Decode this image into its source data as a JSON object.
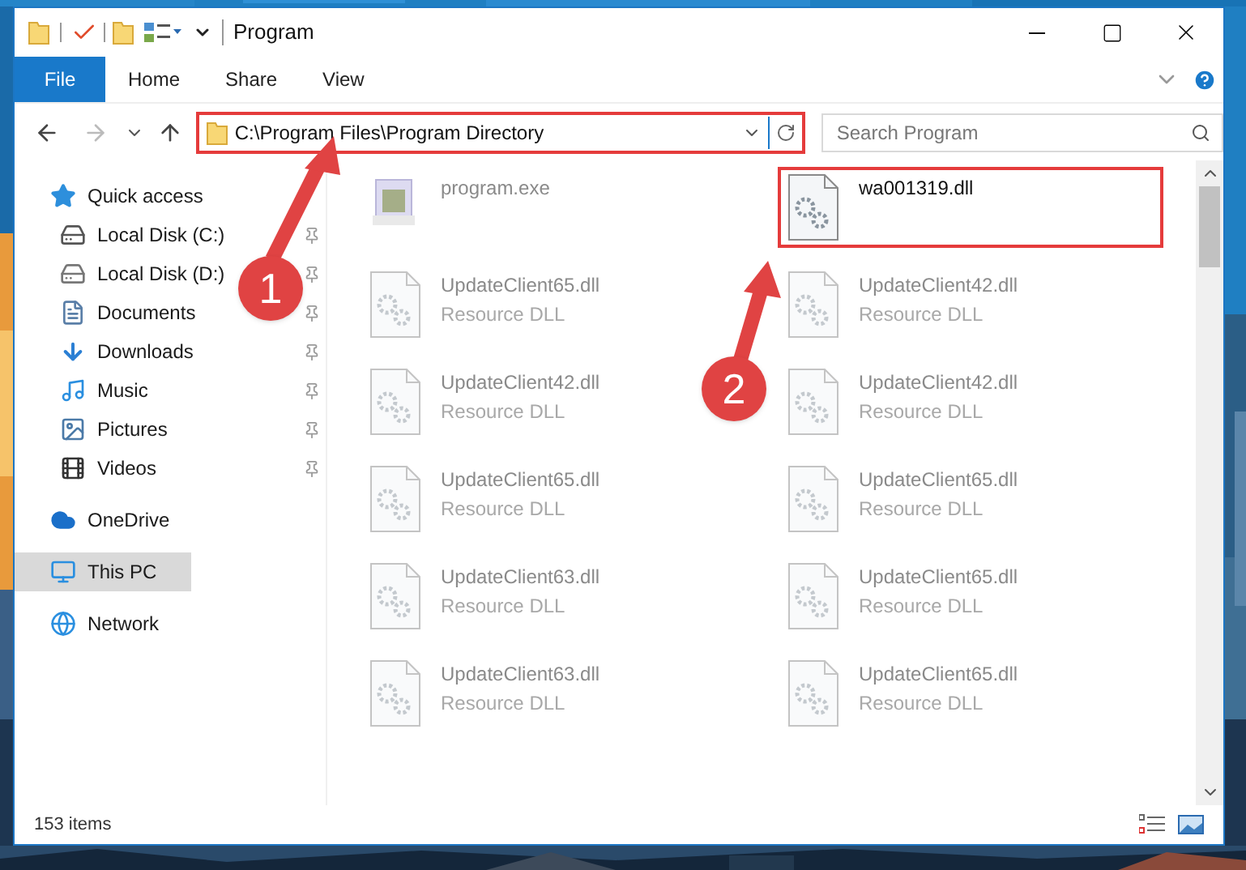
{
  "window": {
    "title": "Program"
  },
  "ribbon_tabs": [
    {
      "label": "File",
      "kind": "file"
    },
    {
      "label": "Home",
      "kind": "tab"
    },
    {
      "label": "Share",
      "kind": "tab"
    },
    {
      "label": "View",
      "kind": "tab"
    }
  ],
  "address": {
    "path": "C:\\Program Files\\Program Directory",
    "highlighted": true
  },
  "search": {
    "placeholder": "Search Program"
  },
  "sidebar": {
    "items": [
      {
        "label": "Quick access",
        "kind": "quick-access",
        "selected": false,
        "children": [
          {
            "label": "Local Disk (C:)",
            "kind": "system-drive",
            "pinned": true,
            "selected": false
          },
          {
            "label": "Local Disk (D:)",
            "kind": "drive",
            "pinned": true,
            "selected": false
          },
          {
            "label": "Documents",
            "kind": "documents",
            "pinned": true,
            "selected": false
          },
          {
            "label": "Downloads",
            "kind": "downloads",
            "pinned": true,
            "selected": false
          },
          {
            "label": "Music",
            "kind": "music",
            "pinned": true,
            "selected": false
          },
          {
            "label": "Pictures",
            "kind": "pictures",
            "pinned": true,
            "selected": false
          },
          {
            "label": "Videos",
            "kind": "videos",
            "pinned": true,
            "selected": false
          }
        ]
      },
      {
        "label": "OneDrive",
        "kind": "onedrive",
        "selected": false
      },
      {
        "label": "This PC",
        "kind": "pc",
        "selected": true
      },
      {
        "label": "Network",
        "kind": "network",
        "selected": false
      }
    ]
  },
  "files": [
    {
      "name": "program.exe",
      "kind": "exe",
      "dimmed": true,
      "highlighted": false
    },
    {
      "name": "wa001319.dll",
      "kind": "dll",
      "dimmed": false,
      "highlighted": true
    },
    {
      "name": "UpdateClient65.dll",
      "type": "Resource DLL",
      "kind": "dll",
      "dimmed": true,
      "highlighted": false
    },
    {
      "name": "UpdateClient42.dll",
      "type": "Resource DLL",
      "kind": "dll",
      "dimmed": true,
      "highlighted": false
    },
    {
      "name": "UpdateClient42.dll",
      "type": "Resource DLL",
      "kind": "dll",
      "dimmed": true,
      "highlighted": false
    },
    {
      "name": "UpdateClient42.dll",
      "type": "Resource DLL",
      "kind": "dll",
      "dimmed": true,
      "highlighted": false
    },
    {
      "name": "UpdateClient65.dll",
      "type": "Resource DLL",
      "kind": "dll",
      "dimmed": true,
      "highlighted": false
    },
    {
      "name": "UpdateClient65.dll",
      "type": "Resource DLL",
      "kind": "dll",
      "dimmed": true,
      "highlighted": false
    },
    {
      "name": "UpdateClient63.dll",
      "type": "Resource DLL",
      "kind": "dll",
      "dimmed": true,
      "highlighted": false
    },
    {
      "name": "UpdateClient65.dll",
      "type": "Resource DLL",
      "kind": "dll",
      "dimmed": true,
      "highlighted": false
    },
    {
      "name": "UpdateClient63.dll",
      "type": "Resource DLL",
      "kind": "dll",
      "dimmed": true,
      "highlighted": false
    },
    {
      "name": "UpdateClient65.dll",
      "type": "Resource DLL",
      "kind": "dll",
      "dimmed": true,
      "highlighted": false
    }
  ],
  "callouts": [
    {
      "label": "1"
    },
    {
      "label": "2"
    }
  ],
  "status_bar": {
    "item_count": "153 items"
  }
}
